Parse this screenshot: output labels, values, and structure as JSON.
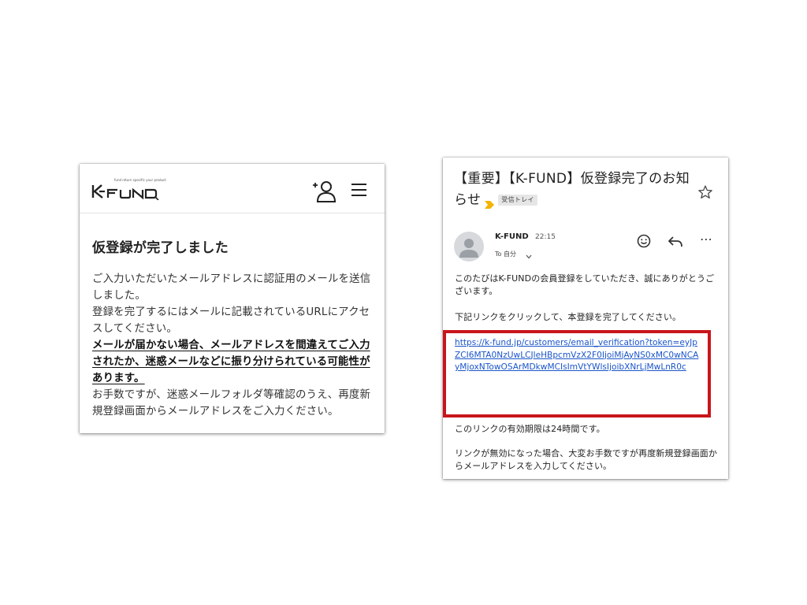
{
  "site": {
    "logo_text": "K-FUND",
    "logo_tagline": "fund return specific your product",
    "page_title": "仮登録が完了しました",
    "paragraphs": [
      "ご入力いただいたメールアドレスに認証用のメールを送信しました。",
      "登録を完了するにはメールに記載されているURLにアクセスしてください。"
    ],
    "warning": "メールが届かない場合、メールアドレスを間違えてご入力されたか、迷惑メールなどに振り分けられている可能性があります。",
    "closing": "お手数ですが、迷惑メールフォルダ等確認のうえ、再度新規登録画面からメールアドレスをご入力ください。",
    "icons": {
      "user_add": "user-add-icon",
      "menu": "hamburger-menu-icon"
    }
  },
  "email": {
    "subject": "【重要】【K-FUND】仮登録完了のお知らせ",
    "label": "受信トレイ",
    "sender": "K-FUND",
    "time": "22:15",
    "recipient": "To 自分",
    "body_intro": "このたびはK-FUNDの会員登録をしていただき、誠にありがとうございます。",
    "body_instruction": "下記リンクをクリックして、本登録を完了してください。",
    "link": "https://k-fund.jp/customers/email_verification?token=eyJpZCI6MTA0NzUwLCJleHBpcmVzX2F0IjoiMjAyNS0xMC0wNCAyMjoxNTowOSArMDkwMCIsImVtYWlsIjoibXNrLjMwLnR0c",
    "validity": "このリンクの有効期限は24時間です。",
    "invalid_notice": "リンクが無効になった場合、大変お手数ですが再度新規登録画面からメールアドレスを入力してください。",
    "icons": {
      "star": "star-icon",
      "emoji": "emoji-icon",
      "reply": "reply-icon",
      "more": "more-icon"
    },
    "colors": {
      "highlight_border": "#c8151b",
      "link": "#1a55c9",
      "label_arrow": "#f4b400"
    }
  }
}
